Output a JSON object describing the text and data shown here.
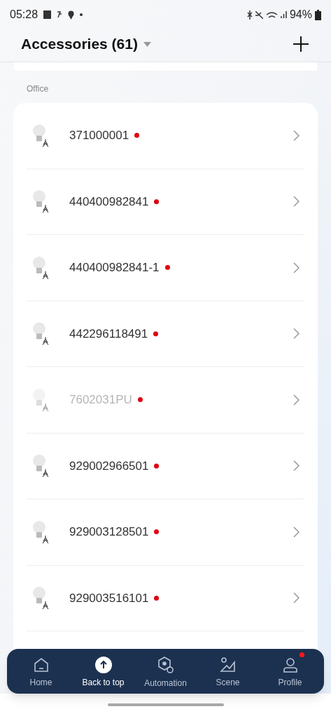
{
  "status_bar": {
    "time": "05:28",
    "battery": "94%"
  },
  "header": {
    "title": "Accessories (61)"
  },
  "section": {
    "label": "Office"
  },
  "accessories": [
    {
      "name": "371000001",
      "disabled": false,
      "alert": true
    },
    {
      "name": "440400982841",
      "disabled": false,
      "alert": true
    },
    {
      "name": "440400982841-1",
      "disabled": false,
      "alert": true
    },
    {
      "name": "442296118491",
      "disabled": false,
      "alert": true
    },
    {
      "name": "7602031PU",
      "disabled": true,
      "alert": true
    },
    {
      "name": "929002966501",
      "disabled": false,
      "alert": true
    },
    {
      "name": "929003128501",
      "disabled": false,
      "alert": true
    },
    {
      "name": "929003516101",
      "disabled": false,
      "alert": true
    }
  ],
  "nav": [
    {
      "label": "Home",
      "kind": "home",
      "selected": false,
      "badge": false
    },
    {
      "label": "Back to top",
      "kind": "top",
      "selected": true,
      "badge": false
    },
    {
      "label": "Automation",
      "kind": "automation",
      "selected": false,
      "badge": false
    },
    {
      "label": "Scene",
      "kind": "scene",
      "selected": false,
      "badge": false
    },
    {
      "label": "Profile",
      "kind": "profile",
      "selected": false,
      "badge": true
    }
  ]
}
